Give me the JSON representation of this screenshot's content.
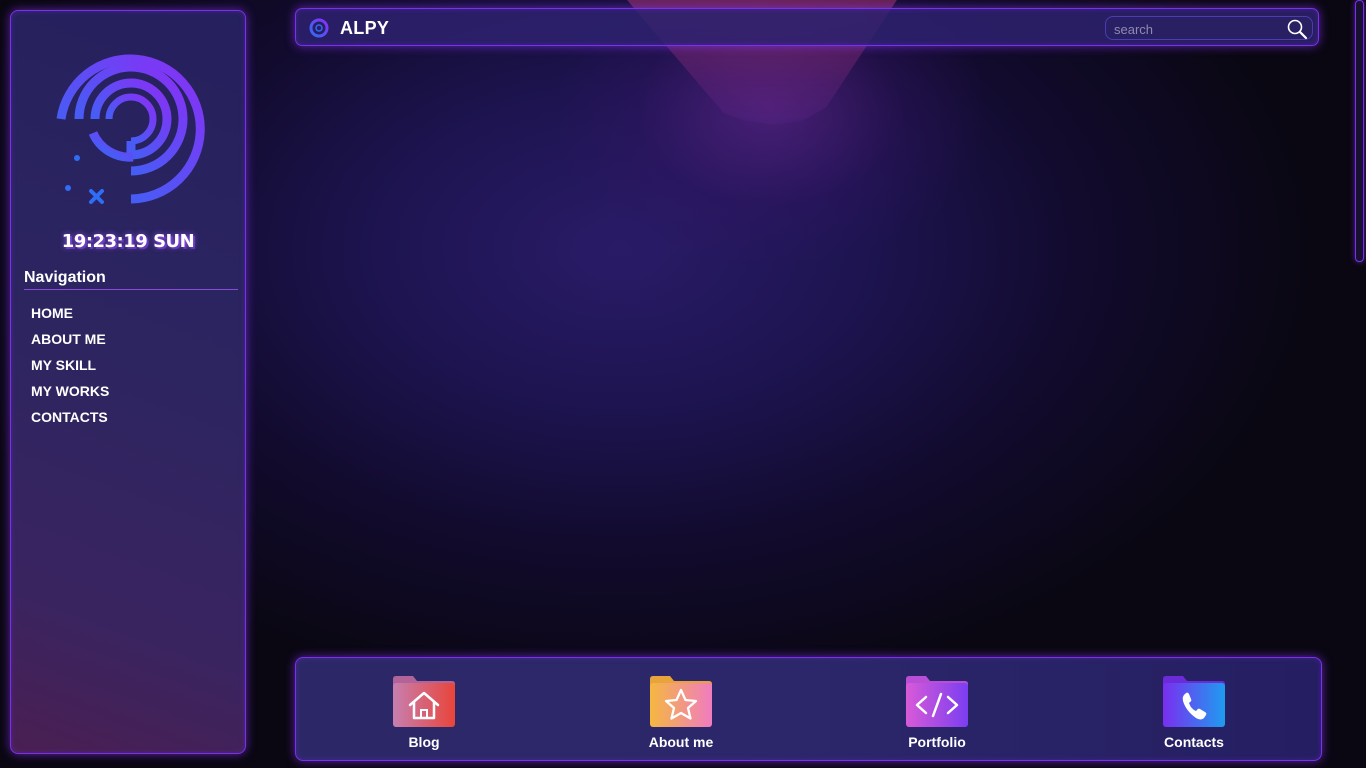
{
  "sidebar": {
    "clock": "19:23:19 SUN",
    "nav_title": "Navigation",
    "nav_items": [
      {
        "label": "HOME"
      },
      {
        "label": "ABOUT ME"
      },
      {
        "label": "MY SKILL"
      },
      {
        "label": "MY WORKS"
      },
      {
        "label": "CONTACTS"
      }
    ],
    "logo_icon": "spiral-logo-icon"
  },
  "topbar": {
    "brand": "ALPY",
    "brand_icon": "ring-logo-icon",
    "search": {
      "placeholder": "search",
      "value": "",
      "icon": "search-icon"
    }
  },
  "dock": {
    "items": [
      {
        "label": "Blog",
        "icon": "folder-home-icon",
        "color": "#e0453f"
      },
      {
        "label": "About me",
        "icon": "folder-star-icon",
        "color": "#f07cc0"
      },
      {
        "label": "Portfolio",
        "icon": "folder-code-icon",
        "color": "#b94ef0"
      },
      {
        "label": "Contacts",
        "icon": "folder-phone-icon",
        "color": "#2f7bf0"
      }
    ]
  },
  "colors": {
    "neon_border": "#7b2ff0",
    "logo_gradient_start": "#2f6df5",
    "logo_gradient_end": "#8a2ef5"
  }
}
